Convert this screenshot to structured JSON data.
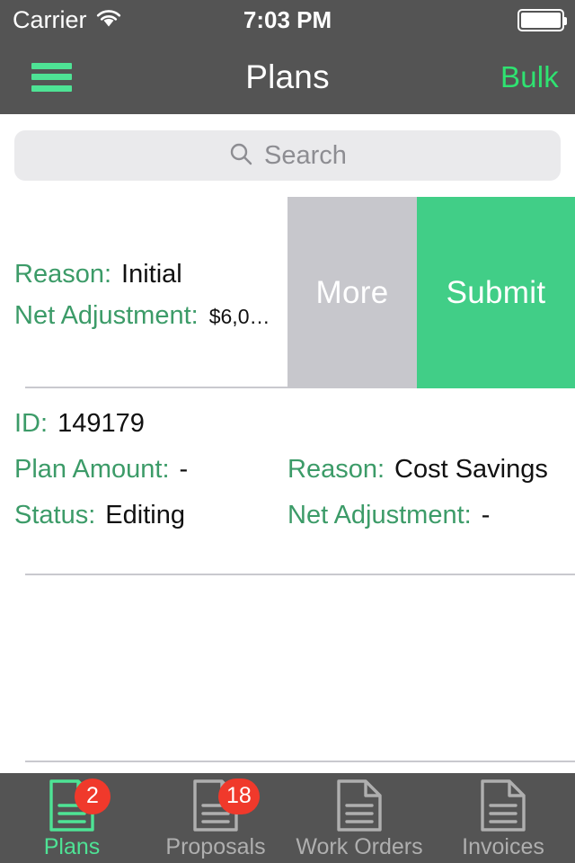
{
  "status_bar": {
    "carrier": "Carrier",
    "wifi_icon": "wifi-icon",
    "time": "7:03 PM",
    "battery_icon": "battery-full-icon"
  },
  "nav_bar": {
    "menu_icon": "hamburger-menu-icon",
    "title": "Plans",
    "right_action": "Bulk"
  },
  "search": {
    "icon": "search-icon",
    "placeholder": "Search",
    "value": ""
  },
  "list": {
    "swiped_row": {
      "fields": [
        {
          "label": "Reason:",
          "value": "Initial"
        },
        {
          "label": "Net Adjustment:",
          "value": "$6,0…"
        }
      ],
      "actions": [
        {
          "label": "More",
          "color": "#C7C7CC"
        },
        {
          "label": "Submit",
          "color": "#41CE87"
        }
      ]
    },
    "rows": [
      {
        "id_label": "ID:",
        "id_value": "149179",
        "left": [
          {
            "label": "Plan Amount:",
            "value": "-"
          },
          {
            "label": "Status:",
            "value": "Editing"
          }
        ],
        "right": [
          {
            "label": "Reason:",
            "value": "Cost Savings"
          },
          {
            "label": "Net Adjustment:",
            "value": "-"
          }
        ]
      }
    ]
  },
  "tab_bar": {
    "items": [
      {
        "label": "Plans",
        "icon": "document-icon",
        "badge": "2",
        "active": true
      },
      {
        "label": "Proposals",
        "icon": "document-icon",
        "badge": "18",
        "active": false
      },
      {
        "label": "Work Orders",
        "icon": "document-icon",
        "badge": "",
        "active": false
      },
      {
        "label": "Invoices",
        "icon": "document-icon",
        "badge": "",
        "active": false
      }
    ]
  },
  "colors": {
    "chrome": "#545454",
    "accent_green": "#4EE395",
    "action_green": "#41CE87",
    "label_green": "#3C9B68",
    "badge_red": "#F0392B",
    "more_gray": "#C7C7CC",
    "search_bg": "#EAEAEC"
  }
}
